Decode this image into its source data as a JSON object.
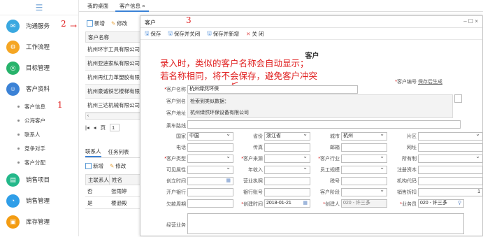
{
  "sidebar": {
    "menu_icon": "☰",
    "items": [
      {
        "label": "沟通服务",
        "icon": "chat-icon",
        "color": "#3aa8e0",
        "glyph": "✉"
      },
      {
        "label": "工作流程",
        "icon": "workflow-icon",
        "color": "#f5a623",
        "glyph": "⚙"
      },
      {
        "label": "目标管理",
        "icon": "target-icon",
        "color": "#27b36b",
        "glyph": "◎"
      },
      {
        "label": "客户资料",
        "icon": "customer-icon",
        "color": "#3b82d6",
        "glyph": "☺"
      }
    ],
    "subitems": [
      "客户信息",
      "公海客户",
      "联系人",
      "竞争对手",
      "客户分配"
    ],
    "items2": [
      {
        "label": "销售项目",
        "icon": "project-icon",
        "color": "#23b88a",
        "glyph": "▤"
      },
      {
        "label": "销售管理",
        "icon": "sales-icon",
        "color": "#2f9ee8",
        "glyph": "◔"
      },
      {
        "label": "库存管理",
        "icon": "stock-icon",
        "color": "#f39c12",
        "glyph": "▣"
      }
    ]
  },
  "topbar": {
    "tabs": [
      "我的桌面",
      "客户信息"
    ],
    "close": "×"
  },
  "list": {
    "new": "新增",
    "edit": "修改",
    "header": "客户名称",
    "rows": [
      "杭州环宇工具有限公司",
      "杭州亚迪家私有限公司",
      "杭州再红力革塑胶有限公司",
      "杭州豪诚铁艺楼梯有限公司",
      "杭州三达机械有限公司"
    ],
    "pager_prev2": "|◂",
    "pager_prev": "◂",
    "pager_label": "页",
    "pager_value": "1"
  },
  "contacts": {
    "tabs": [
      "联系人",
      "任务列表"
    ],
    "new": "新增",
    "edit": "修改",
    "headers": [
      "主联系人",
      "姓名"
    ],
    "rows": [
      [
        "否",
        "张雨婷"
      ],
      [
        "是",
        "楼逊殿"
      ]
    ]
  },
  "dialog": {
    "title": "客户",
    "toolbar": [
      "保存",
      "保存并关闭",
      "保存并新增",
      "关 闭"
    ],
    "win_controls": "– ☐ ×",
    "heading": "客户"
  },
  "annotations": {
    "n1": "1",
    "n2": "2",
    "n3": "3",
    "line1": "录入时，类似的客户名称会自动显示；",
    "line2": "若名称相同，将不会保存，避免客户冲突"
  },
  "form": {
    "name_label": "客户名称",
    "name_value": "杭州绿然环保",
    "code_label": "客户编号",
    "code_link": "保存后生成",
    "alias_label": "客户别名",
    "suggest_title": "检索到类似数据：",
    "addr_label": "客户地址",
    "suggest_item": "杭州绿然环保设备有限公司",
    "route_label": "乘车路线",
    "country_label": "国家",
    "country": "中国",
    "province_label": "省份",
    "province": "浙江省",
    "city_label": "城市",
    "city": "杭州",
    "area_label": "片区",
    "phone_label": "电话",
    "fax_label": "传真",
    "email_label": "邮箱",
    "site_label": "网址",
    "type_label": "客户类型",
    "source_label": "客户来源",
    "industry_label": "客户行业",
    "owner_label": "所有制",
    "vis_label": "可见属性",
    "income_label": "年收入",
    "staff_label": "员工规模",
    "capital_label": "注册资本",
    "found_label": "创立时间",
    "license_label": "营业执照",
    "tax_label": "税号",
    "org_label": "机构代码",
    "bank_label": "开户银行",
    "account_label": "银行账号",
    "stage_label": "客户阶段",
    "discount_label": "销售折扣",
    "discount": "1",
    "debt_label": "欠款周期",
    "ctime_label": "创建时间",
    "ctime": "2018-01-21",
    "creator_label": "创建人",
    "creator": "020 - 许三多",
    "sales_label": "业务员",
    "sales": "020 - 许三多",
    "biz_label": "经营业务"
  }
}
